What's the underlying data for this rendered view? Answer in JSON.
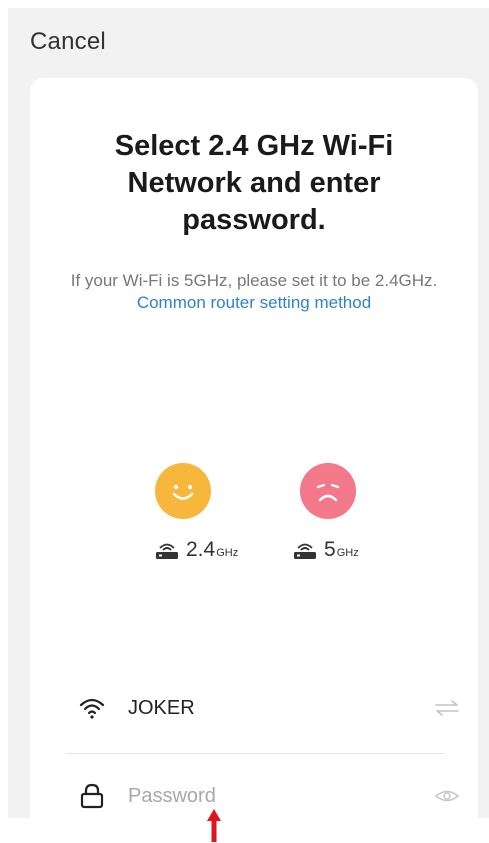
{
  "header": {
    "cancel_label": "Cancel"
  },
  "card": {
    "title": "Select 2.4 GHz Wi-Fi Network and enter password.",
    "subtitle_text": "If your Wi-Fi is 5GHz, please set it to be 2.4GHz.",
    "subtitle_link": "Common router setting method"
  },
  "bands": [
    {
      "icon": "happy-face-icon",
      "value": "2.4",
      "unit": "GHz",
      "color": "#f6b73c"
    },
    {
      "icon": "sad-face-icon",
      "value": "5",
      "unit": "GHz",
      "color": "#f2788a"
    }
  ],
  "wifi": {
    "ssid": "JOKER",
    "icon": "wifi-icon",
    "switch_icon": "switch-network-icon"
  },
  "password": {
    "placeholder": "Password",
    "value": "",
    "icon": "lock-icon",
    "toggle_icon": "eye-icon"
  },
  "colors": {
    "link": "#2f82c9",
    "annotation_arrow": "#e0141e"
  }
}
